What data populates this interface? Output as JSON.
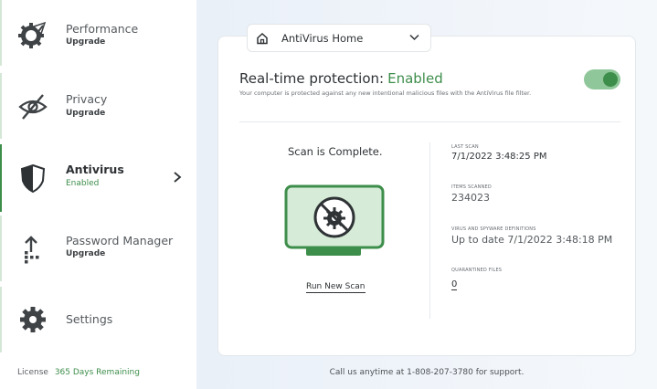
{
  "sidebar": {
    "items": [
      {
        "label": "Performance",
        "sub": "Upgrade",
        "icon": "performance-gear-icon"
      },
      {
        "label": "Privacy",
        "sub": "Upgrade",
        "icon": "eye-slash-icon"
      },
      {
        "label": "Antivirus",
        "sub": "Enabled",
        "icon": "shield-icon"
      },
      {
        "label": "Password Manager",
        "sub": "Upgrade",
        "icon": "password-upload-icon"
      },
      {
        "label": "Settings",
        "sub": "",
        "icon": "gear-icon"
      }
    ],
    "license_label": "License",
    "license_value": "365 Days Remaining"
  },
  "dropdown": {
    "label": "AntiVirus Home"
  },
  "realtime": {
    "title": "Real-time protection:",
    "status": "Enabled",
    "description": "Your computer is protected against any new intentional malicious files with the AntiVirus file filter."
  },
  "scan": {
    "title": "Scan is Complete.",
    "run_label": "Run New Scan"
  },
  "stats": {
    "last_scan_label": "LAST SCAN",
    "last_scan_value": "7/1/2022 3:48:25 PM",
    "items_label": "ITEMS SCANNED",
    "items_value": "234023",
    "defs_label": "VIRUS AND SPYWARE DEFINITIONS",
    "defs_value": "Up to date 7/1/2022 3:48:18 PM",
    "quarantine_label": "QUARANTINED FILES",
    "quarantine_value": "0"
  },
  "footer": {
    "support": "Call us anytime at 1-808-207-3780 for support."
  },
  "colors": {
    "accent": "#3e8e4b",
    "toggle_track": "#8fc79a",
    "monitor_fill": "#d6ecd8"
  }
}
